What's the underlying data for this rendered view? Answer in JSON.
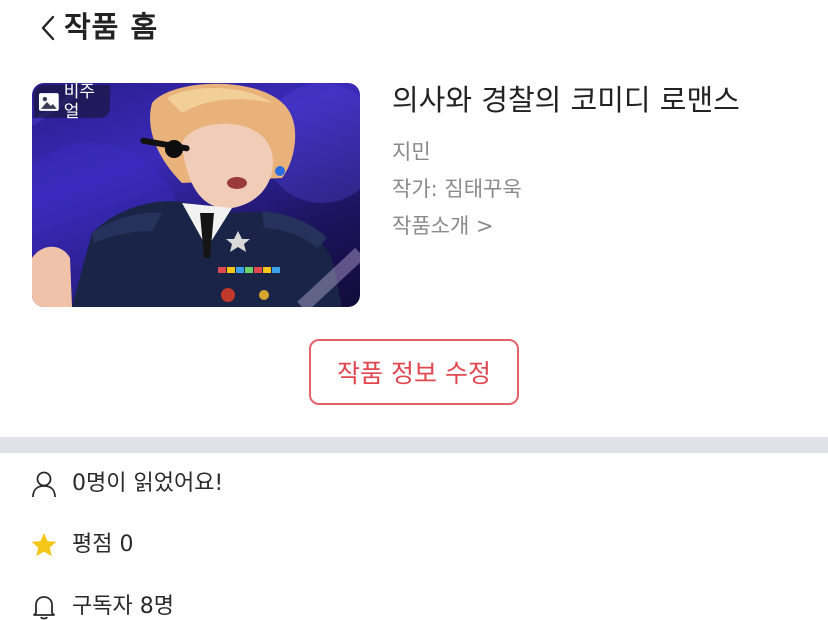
{
  "header": {
    "back_icon": "chevron-left-icon",
    "title": "작품 홈"
  },
  "work": {
    "cover_badge_icon": "image-icon",
    "cover_badge_label": "비주얼",
    "title": "의사와 경찰의 코미디 로맨스",
    "character": "지민",
    "author": "작가: 짐태꾸욱",
    "intro_link": "작품소개 >"
  },
  "actions": {
    "edit_label": "작품 정보 수정",
    "edit_color": "#e0474f"
  },
  "stats": {
    "readers": {
      "icon": "person-icon",
      "text": "0명이 읽었어요!"
    },
    "rating": {
      "icon": "star-icon",
      "text": "평점 0",
      "icon_color": "#f5c518"
    },
    "subscribers": {
      "icon": "bell-icon",
      "text": "구독자 8명"
    }
  },
  "colors": {
    "divider": "#dfe3e8",
    "muted_text": "#8a8a8a"
  }
}
